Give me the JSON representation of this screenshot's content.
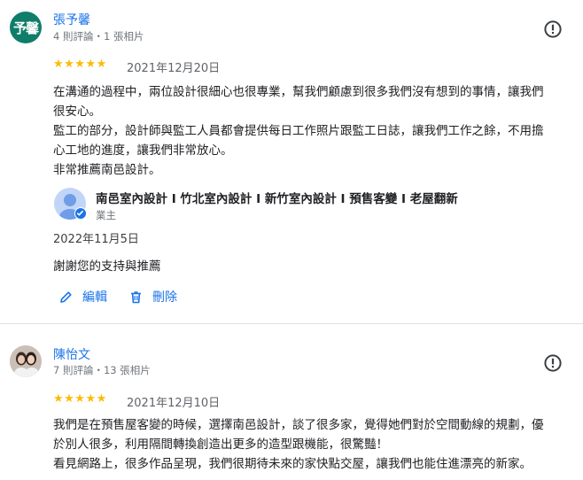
{
  "reviews": [
    {
      "avatar_text": "予馨",
      "name": "張予馨",
      "meta": "4 則評論・1 張相片",
      "stars": "★★★★★",
      "date": "2021年12月20日",
      "text": "在溝通的過程中，兩位設計很細心也很專業，幫我們顧慮到很多我們沒有想到的事情，讓我們\n很安心。\n監工的部分，設計師與監工人員都會提供每日工作照片跟監工日誌，讓我們工作之餘，不用擔\n心工地的進度，讓我們非常放心。\n非常推薦南邑設計。",
      "reply": {
        "owner_name": "南邑室內設計 I 竹北室內設計 I 新竹室內設計 I 預售客變 I 老屋翻新",
        "owner_role": "業主",
        "date": "2022年11月5日",
        "text": "謝謝您的支持與推薦",
        "edit_label": "編輯",
        "delete_label": "刪除"
      }
    },
    {
      "name": "陳怡文",
      "meta": "7 則評論・13 張相片",
      "stars": "★★★★★",
      "date": "2021年12月10日",
      "text": "我們是在預售屋客變的時候，選擇南邑設計，談了很多家，覺得她們對於空間動線的規劃，優\n於別人很多，利用隔間轉換創造出更多的造型跟機能，很驚豔！\n看見網路上，很多作品呈現，我們很期待未來的家快點交屋，讓我們也能住進漂亮的新家。"
    }
  ],
  "colors": {
    "accent": "#1a73e8",
    "star": "#fbbc04",
    "avatar_bg": "#0f7d6a"
  },
  "icons": {
    "report": "report-flag-icon",
    "edit": "pencil-icon",
    "delete": "trash-icon",
    "verified": "check-badge-icon"
  }
}
